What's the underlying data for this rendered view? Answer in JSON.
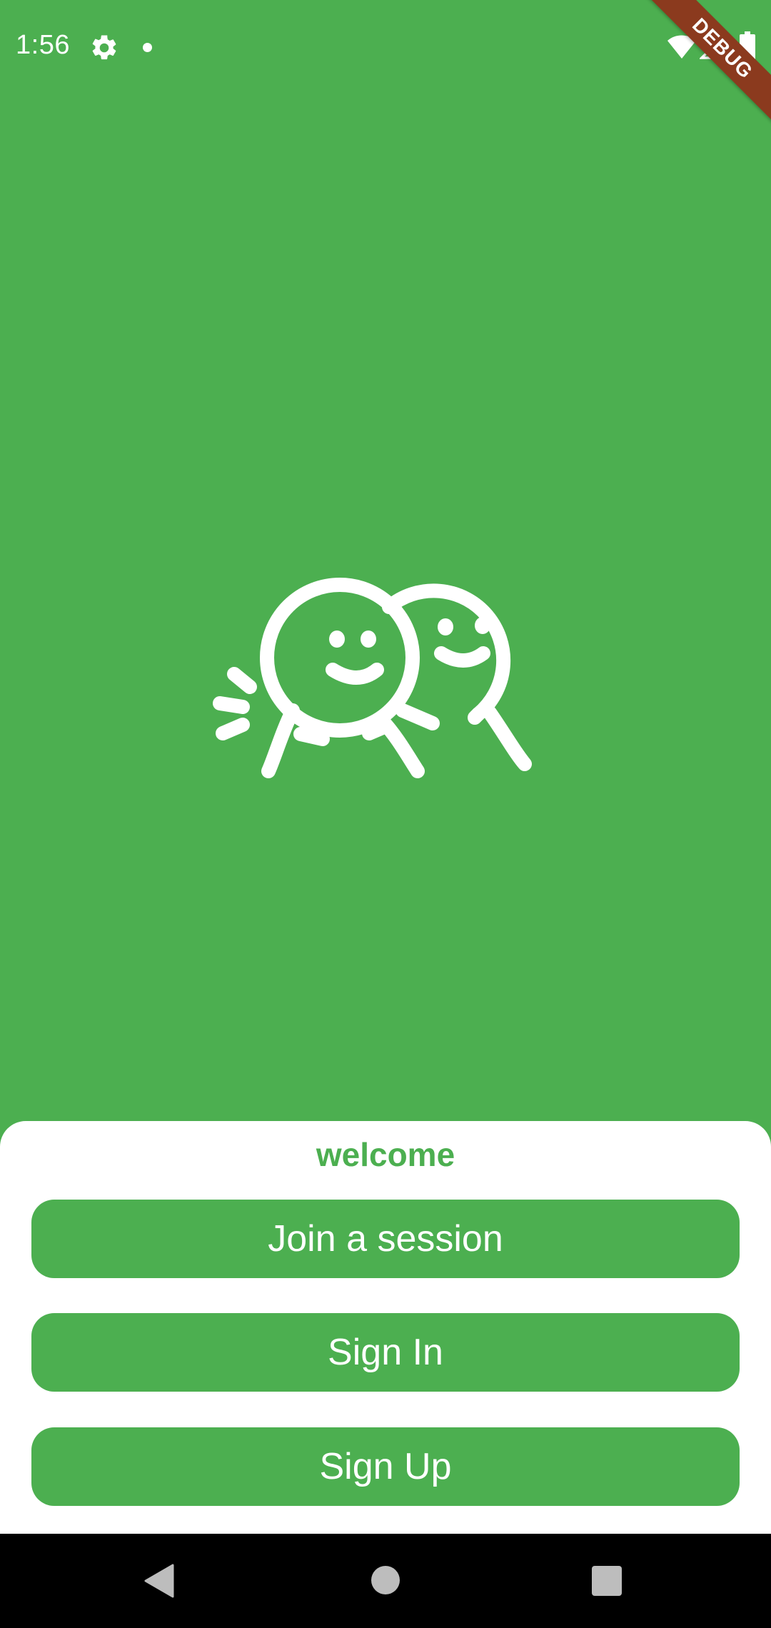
{
  "status_bar": {
    "time": "1:56",
    "icons": [
      "gear-icon",
      "notification-dot-icon",
      "wifi-icon",
      "signal-icon",
      "battery-icon"
    ]
  },
  "debug_banner": {
    "label": "DEBUG",
    "color": "#8B3A1E"
  },
  "logo": {
    "icon": "two-smiling-characters-icon",
    "color": "#ffffff"
  },
  "sheet": {
    "title": "welcome",
    "buttons": {
      "join": "Join a session",
      "sign_in": "Sign In",
      "sign_up": "Sign Up"
    }
  },
  "nav_bar": {
    "icons": [
      "back-icon",
      "home-icon",
      "recents-icon"
    ]
  },
  "theme": {
    "primary": "#4CAF50",
    "surface": "#ffffff",
    "nav_background": "#000000"
  }
}
